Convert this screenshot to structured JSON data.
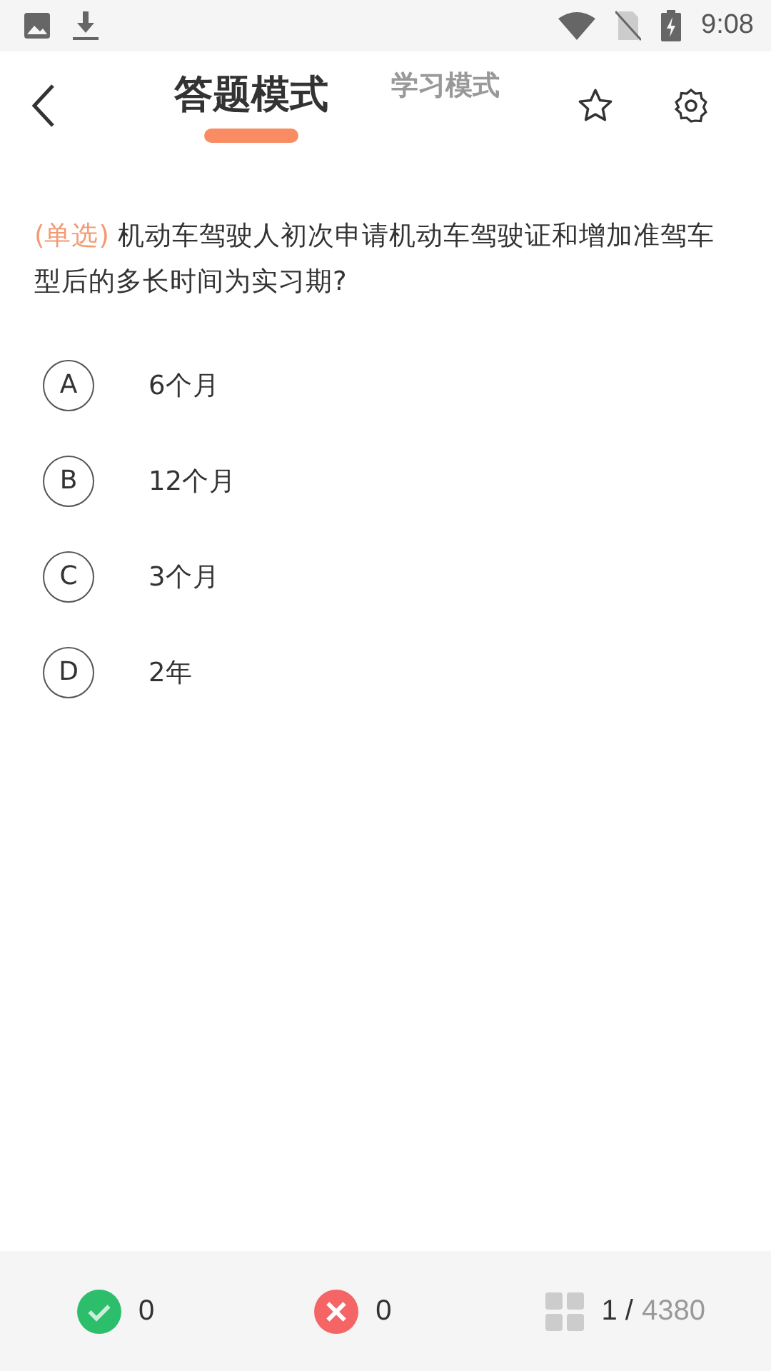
{
  "status_bar": {
    "time": "9:08"
  },
  "tabs": [
    {
      "label": "答题模式",
      "selected": true
    },
    {
      "label": "学习模式",
      "selected": false
    }
  ],
  "question": {
    "type": "(单选)",
    "text": "机动车驾驶人初次申请机动车驾驶证和增加准驾车型后的多长时间为实习期?"
  },
  "options": [
    {
      "letter": "A",
      "text": "6个月"
    },
    {
      "letter": "B",
      "text": "12个月"
    },
    {
      "letter": "C",
      "text": "3个月"
    },
    {
      "letter": "D",
      "text": "2年"
    }
  ],
  "footer": {
    "correct": "0",
    "wrong": "0",
    "current": "1 /",
    "total": "4380"
  }
}
